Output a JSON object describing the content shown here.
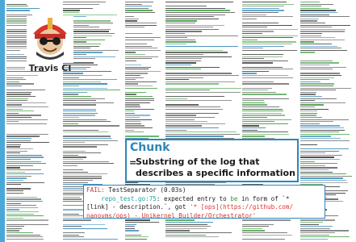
{
  "logo": {
    "name": "Travis CI",
    "icon": "travis-ci-mascot-icon"
  },
  "chunk_card": {
    "title": "Chunk",
    "equals": "=",
    "definition": "Substring of the log that describes a specific information"
  },
  "sample_log": {
    "status": "FAIL:",
    "test_line": " TestSeparator (0.03s)",
    "file_ref": "repo_test.go:75",
    "msg_part1": ": expected entry to ",
    "msg_be": "be",
    "msg_part2": " in form of `*",
    "msg_line2a": "[link] - description.`, got ",
    "msg_quote_open": "'* [ops](https://github.com/",
    "msg_line3": "nanovms/ops) - Unikernel Builder/Orchestrator'"
  },
  "colors": {
    "accent": "#2e86b8",
    "sidebar": "#4aa8d8",
    "fail": "#d9342b",
    "file_ref": "#1aa4a4",
    "keyword": "#3a9a3a"
  }
}
